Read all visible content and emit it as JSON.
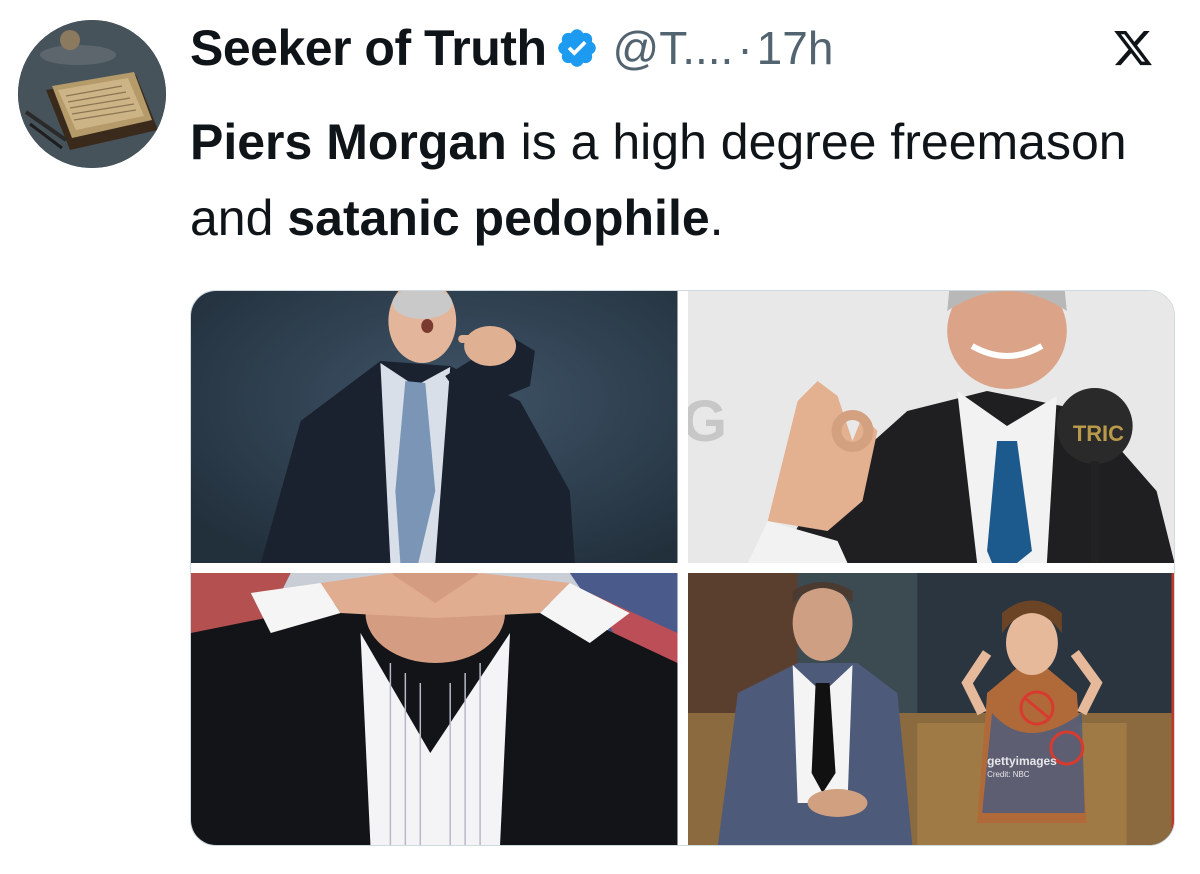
{
  "author": {
    "display_name": "Seeker of Truth",
    "handle": "@T....",
    "separator": "·",
    "time": "17h",
    "avatar_icon": "book-and-quill-avatar",
    "verified_icon": "verified-badge-icon",
    "verified_color": "#1d9bf0"
  },
  "platform_icon": "x-logo-icon",
  "tweet": {
    "segments": [
      {
        "text": "Piers Morgan",
        "bold": true
      },
      {
        "text": " is a high degree freemason and ",
        "bold": false
      },
      {
        "text": "satanic pedophile",
        "bold": true
      },
      {
        "text": ".",
        "bold": false
      }
    ]
  },
  "media": {
    "images": [
      {
        "name": "photo-pointing-man",
        "overlay_text": ""
      },
      {
        "name": "photo-ok-hand-gesture",
        "overlay_text": "G",
        "award_text": "TRIC"
      },
      {
        "name": "photo-hands-over-eyes",
        "overlay_text": ""
      },
      {
        "name": "photo-talk-show-with-girl",
        "watermark": "gettyimages",
        "credit": "Credit: NBC"
      }
    ]
  }
}
